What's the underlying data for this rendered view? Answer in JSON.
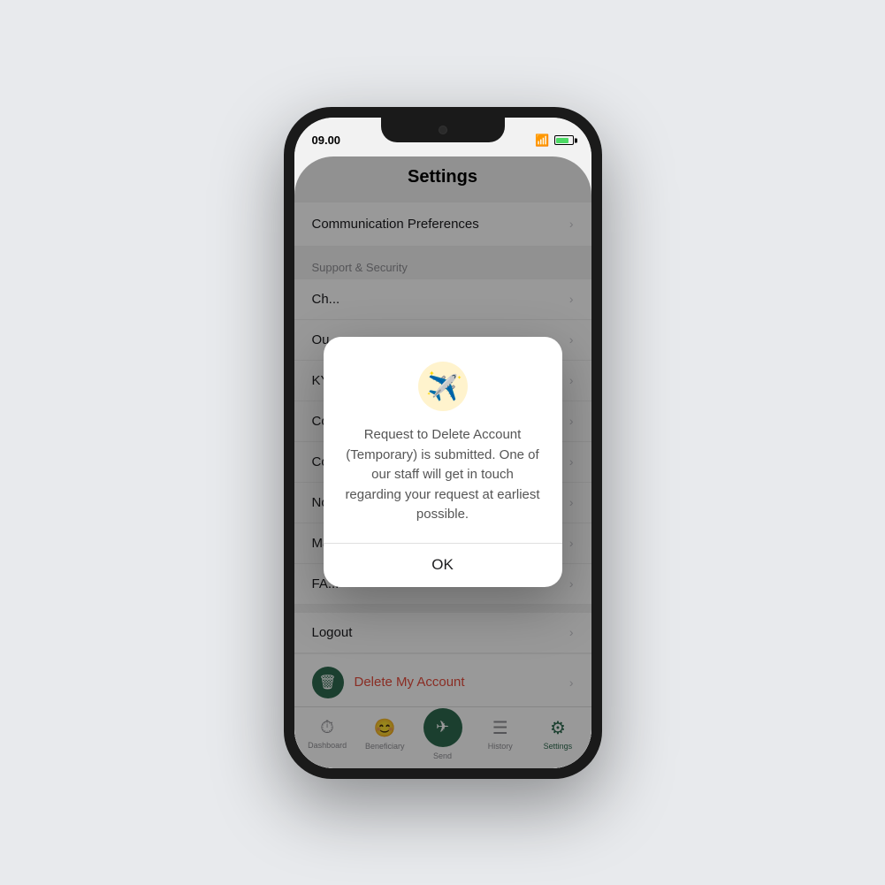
{
  "phone": {
    "status_bar": {
      "time": "09.00",
      "wifi": "📶",
      "battery": "🔋"
    }
  },
  "page": {
    "title": "Settings"
  },
  "settings": {
    "comm_pref_label": "Communication Preferences",
    "support_section_label": "Support & Security",
    "items": [
      {
        "label": "Ch..."
      },
      {
        "label": "Ou..."
      },
      {
        "label": "KYC..."
      },
      {
        "label": "Co..."
      },
      {
        "label": "Co..."
      },
      {
        "label": "No..."
      },
      {
        "label": "Ma..."
      },
      {
        "label": "FA..."
      }
    ],
    "logout_label": "Logout",
    "delete_account_label": "Delete My Account"
  },
  "tabs": [
    {
      "label": "Dashboard",
      "icon": "🕐",
      "active": false
    },
    {
      "label": "Beneficiary",
      "icon": "😊",
      "active": false
    },
    {
      "label": "Send",
      "icon": "➤",
      "active": false
    },
    {
      "label": "History",
      "icon": "≡",
      "active": false
    },
    {
      "label": "Settings",
      "icon": "⚙",
      "active": true
    }
  ],
  "modal": {
    "title": "Request to Delete Account",
    "message": "Request to Delete Account (Temporary) is submitted. One of our staff will get in touch regarding your request at earliest possible.",
    "ok_label": "OK"
  }
}
